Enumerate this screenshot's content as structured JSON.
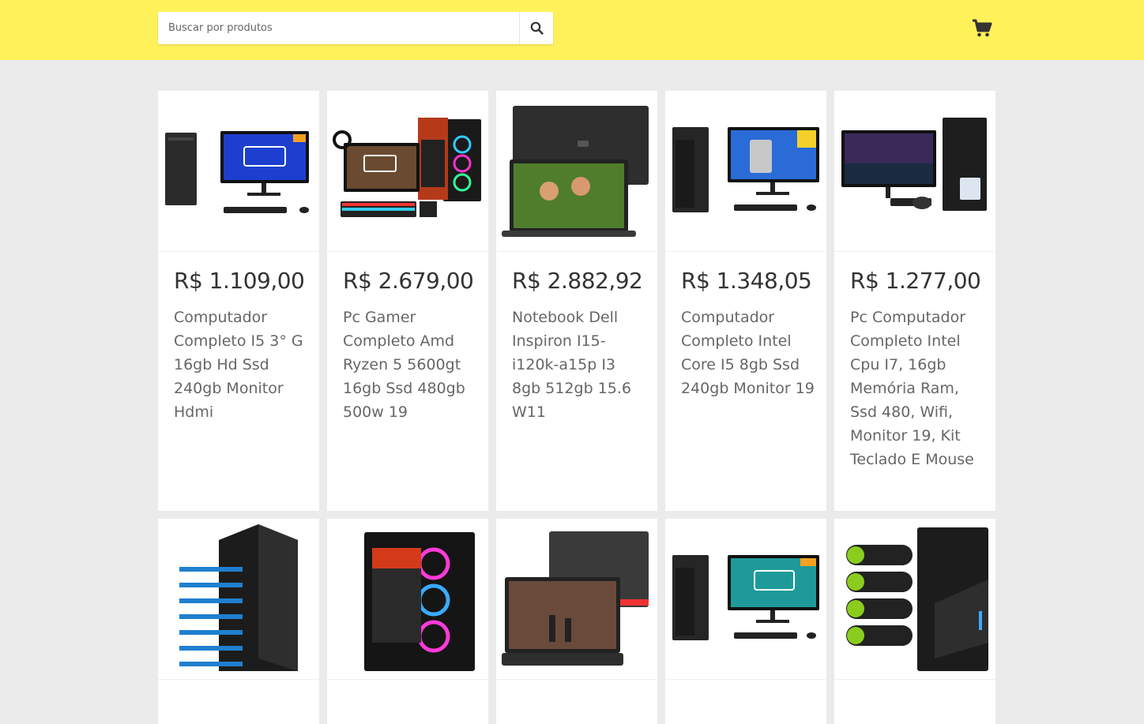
{
  "header": {
    "search_placeholder": "Buscar por produtos",
    "search_icon": "search-icon",
    "cart_icon": "cart-icon",
    "background": "#fff159"
  },
  "products": [
    {
      "price": "R$ 1.109,00",
      "title": "Computador Completo I5 3° G 16gb Hd Ssd 240gb Monitor Hdmi",
      "image": "desktop-pc-with-monitor"
    },
    {
      "price": "R$ 2.679,00",
      "title": "Pc Gamer Completo Amd Ryzen 5 5600gt 16gb Ssd 480gb 500w 19",
      "image": "gamer-pc-kit"
    },
    {
      "price": "R$ 2.882,92",
      "title": "Notebook Dell Inspiron I15-i120k-a15p I3 8gb 512gb 15.6 W11",
      "image": "laptop"
    },
    {
      "price": "R$ 1.348,05",
      "title": "Computador Completo Intel Core I5 8gb Ssd 240gb Monitor 19",
      "image": "desktop-pc-with-monitor"
    },
    {
      "price": "R$ 1.277,00",
      "title": "Pc Computador Completo Intel Cpu I7, 16gb Memória Ram, Ssd 480, Wifi, Monitor 19, Kit Teclado E Mouse",
      "image": "desktop-pc-with-monitor"
    },
    {
      "price": "",
      "title": "",
      "image": "pc-tower"
    },
    {
      "price": "",
      "title": "",
      "image": "gamer-pc-tower"
    },
    {
      "price": "",
      "title": "",
      "image": "laptop"
    },
    {
      "price": "",
      "title": "",
      "image": "desktop-pc-with-monitor"
    },
    {
      "price": "",
      "title": "",
      "image": "pc-tower"
    }
  ]
}
